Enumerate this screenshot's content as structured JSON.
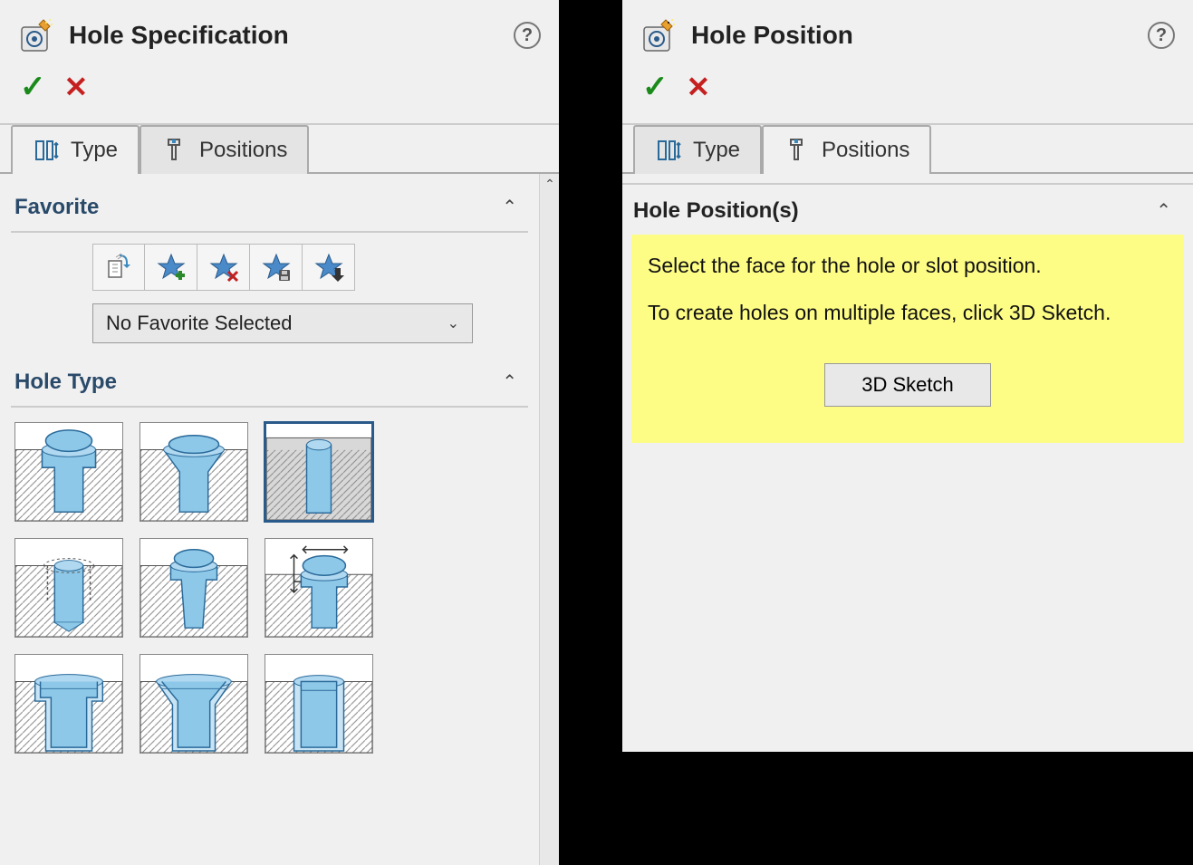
{
  "left": {
    "title": "Hole Specification",
    "tabs": {
      "type": "Type",
      "positions": "Positions"
    },
    "sections": {
      "favorite": "Favorite",
      "hole_type": "Hole Type"
    },
    "favorite_dropdown": "No Favorite Selected",
    "favorite_buttons": [
      {
        "name": "apply-defaults",
        "icon": "doc-arrow"
      },
      {
        "name": "add-favorite",
        "icon": "star-plus"
      },
      {
        "name": "remove-favorite",
        "icon": "star-x"
      },
      {
        "name": "save-favorite",
        "icon": "star-save"
      },
      {
        "name": "load-favorite",
        "icon": "star-down"
      }
    ],
    "hole_types": [
      "counterbore",
      "countersink",
      "hole",
      "straight-tap",
      "tapered-tap",
      "legacy-hole",
      "counterbore-slot",
      "countersink-slot",
      "slot"
    ]
  },
  "right": {
    "title": "Hole Position",
    "tabs": {
      "type": "Type",
      "positions": "Positions"
    },
    "section_title": "Hole Position(s)",
    "hint_line1": "Select the face for the hole or slot position.",
    "hint_line2": "To create holes on multiple faces, click 3D Sketch.",
    "sketch_button": "3D Sketch"
  }
}
